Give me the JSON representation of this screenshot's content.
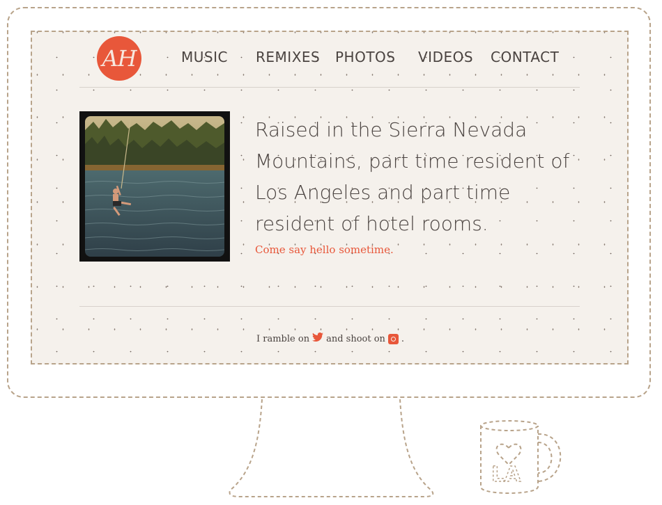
{
  "logo": {
    "text": "AH"
  },
  "nav": [
    {
      "label": "MUSIC"
    },
    {
      "label": "REMIXES"
    },
    {
      "label": "PHOTOS"
    },
    {
      "label": "VIDEOS"
    },
    {
      "label": "CONTACT"
    }
  ],
  "intro": {
    "headline": "Raised in the Sierra Nevada Mountains, part time resident of Los Angeles and part time resident of hotel rooms.",
    "hello_link": "Come say hello sometime."
  },
  "footer": {
    "text_before": "I ramble on",
    "text_middle": "and shoot on",
    "text_after": ".",
    "twitter_icon": "twitter-bird-icon",
    "instagram_icon": "instagram-icon"
  },
  "mug": {
    "text": "LA",
    "icon": "heart-icon"
  },
  "colors": {
    "accent": "#e8573a",
    "background": "#f5f1ec",
    "text": "#4a4340",
    "dashed_outline": "#b8a38a"
  }
}
